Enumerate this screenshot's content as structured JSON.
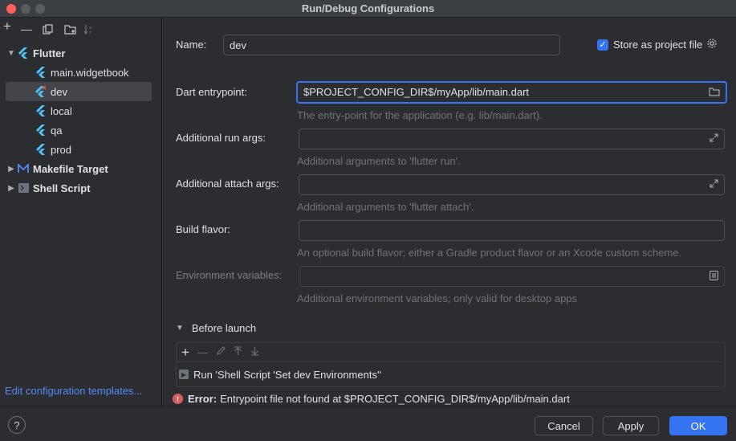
{
  "window": {
    "title": "Run/Debug Configurations"
  },
  "toolbar": {
    "add_icon": "+",
    "remove_icon": "—",
    "copy_icon": "copy-icon",
    "folder_icon": "new-folder-icon",
    "sort_icon": "sort-icon"
  },
  "tree": {
    "flutter": {
      "label": "Flutter",
      "children": [
        "main.widgetbook",
        "dev",
        "local",
        "qa",
        "prod"
      ]
    },
    "makefile": {
      "label": "Makefile Target"
    },
    "shell": {
      "label": "Shell Script"
    }
  },
  "left_footer": {
    "edit_templates": "Edit configuration templates..."
  },
  "form": {
    "name_label": "Name:",
    "name_value": "dev",
    "store_label": "Store as project file",
    "entrypoint_label": "Dart entrypoint:",
    "entrypoint_value": "$PROJECT_CONFIG_DIR$/myApp/lib/main.dart",
    "entrypoint_hint": "The entry-point for the application (e.g. lib/main.dart).",
    "run_args_label": "Additional run args:",
    "run_args_hint": "Additional arguments to 'flutter run'.",
    "attach_args_label": "Additional attach args:",
    "attach_args_hint": "Additional arguments to 'flutter attach'.",
    "build_flavor_label": "Build flavor:",
    "build_flavor_hint": "An optional build flavor; either a Gradle product flavor or an Xcode custom scheme.",
    "env_label": "Environment variables:",
    "env_hint": "Additional environment variables; only valid for desktop apps"
  },
  "before_launch": {
    "label": "Before launch",
    "task": "Run 'Shell Script 'Set dev Environments''"
  },
  "error": {
    "prefix": "Error:",
    "message": "Entrypoint file not found at $PROJECT_CONFIG_DIR$/myApp/lib/main.dart"
  },
  "buttons": {
    "help": "?",
    "cancel": "Cancel",
    "apply": "Apply",
    "ok": "OK"
  },
  "colors": {
    "accent": "#3574f0",
    "error": "#db5c5c",
    "link": "#548af7",
    "flutter": "#4fc3f7"
  }
}
